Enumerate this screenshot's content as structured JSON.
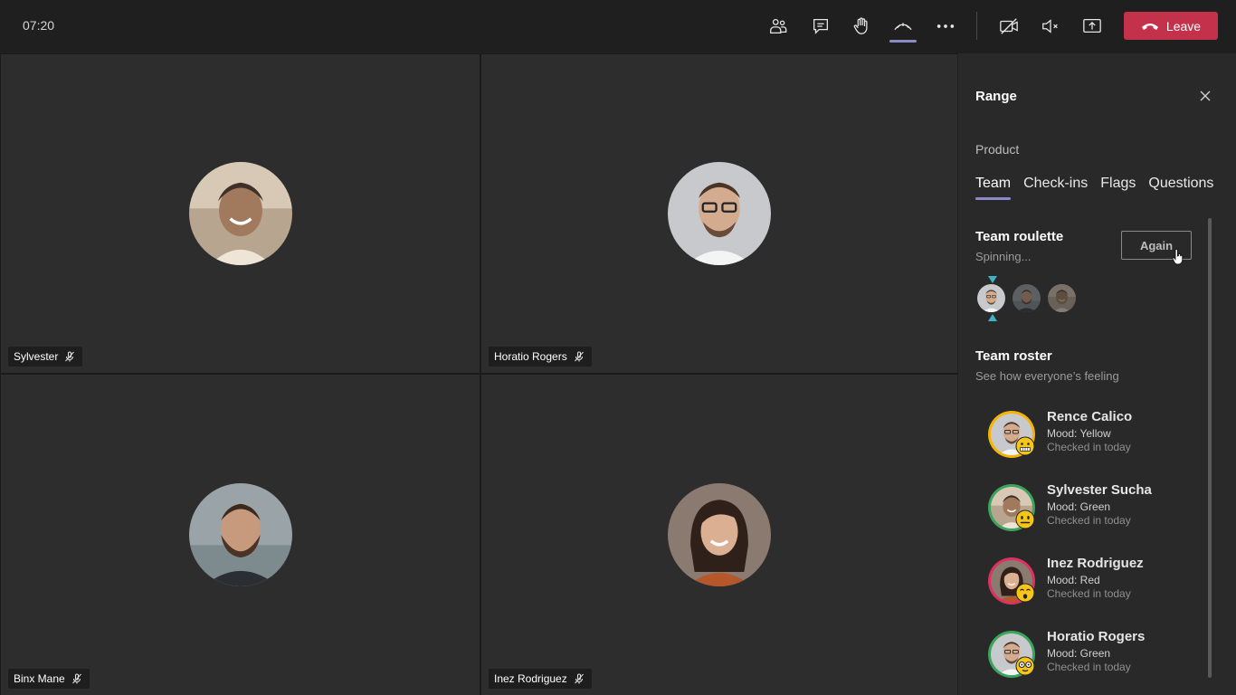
{
  "topbar": {
    "time": "07:20",
    "leave_label": "Leave",
    "icons": [
      "people-icon",
      "chat-icon",
      "raise-hand-icon",
      "apps-icon",
      "more-icon",
      "camera-off-icon",
      "speaker-muted-icon",
      "share-screen-icon",
      "phone-hangup-icon"
    ]
  },
  "participants": [
    {
      "name": "Sylvester"
    },
    {
      "name": "Horatio Rogers"
    },
    {
      "name": "Binx Mane"
    },
    {
      "name": "Inez Rodriguez"
    }
  ],
  "panel": {
    "title": "Range",
    "subheading": "Product",
    "tabs": [
      {
        "label": "Team"
      },
      {
        "label": "Check-ins"
      },
      {
        "label": "Flags"
      },
      {
        "label": "Questions"
      }
    ],
    "roulette": {
      "title": "Team roulette",
      "status": "Spinning...",
      "again_label": "Again"
    },
    "roster": {
      "title": "Team roster",
      "subtitle": "See how everyone’s feeling",
      "members": [
        {
          "name": "Rence Calico",
          "mood": "Mood: Yellow",
          "checked": "Checked in today",
          "color": "#f5b400"
        },
        {
          "name": "Sylvester Sucha",
          "mood": "Mood: Green",
          "checked": "Checked in today",
          "color": "#3ba55d"
        },
        {
          "name": "Inez Rodriguez",
          "mood": "Mood: Red",
          "checked": "Checked in today",
          "color": "#e03060"
        },
        {
          "name": "Horatio Rogers",
          "mood": "Mood: Green",
          "checked": "Checked in today",
          "color": "#3ba55d"
        }
      ]
    }
  },
  "colors": {
    "accent": "#8b8cc7",
    "leave": "#c4314b",
    "marker": "#3fb3c4"
  }
}
